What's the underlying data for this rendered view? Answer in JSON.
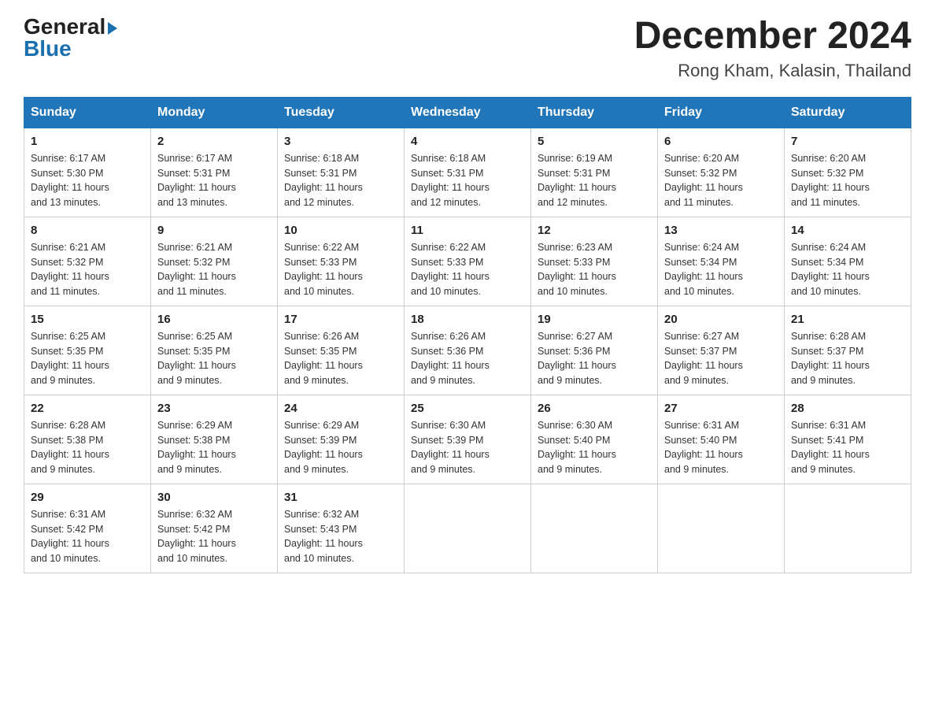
{
  "header": {
    "logo_line1": "General",
    "logo_line2": "Blue",
    "month_year": "December 2024",
    "location": "Rong Kham, Kalasin, Thailand"
  },
  "days_of_week": [
    "Sunday",
    "Monday",
    "Tuesday",
    "Wednesday",
    "Thursday",
    "Friday",
    "Saturday"
  ],
  "weeks": [
    [
      {
        "day": "1",
        "sunrise": "6:17 AM",
        "sunset": "5:30 PM",
        "daylight": "11 hours and 13 minutes."
      },
      {
        "day": "2",
        "sunrise": "6:17 AM",
        "sunset": "5:31 PM",
        "daylight": "11 hours and 13 minutes."
      },
      {
        "day": "3",
        "sunrise": "6:18 AM",
        "sunset": "5:31 PM",
        "daylight": "11 hours and 12 minutes."
      },
      {
        "day": "4",
        "sunrise": "6:18 AM",
        "sunset": "5:31 PM",
        "daylight": "11 hours and 12 minutes."
      },
      {
        "day": "5",
        "sunrise": "6:19 AM",
        "sunset": "5:31 PM",
        "daylight": "11 hours and 12 minutes."
      },
      {
        "day": "6",
        "sunrise": "6:20 AM",
        "sunset": "5:32 PM",
        "daylight": "11 hours and 11 minutes."
      },
      {
        "day": "7",
        "sunrise": "6:20 AM",
        "sunset": "5:32 PM",
        "daylight": "11 hours and 11 minutes."
      }
    ],
    [
      {
        "day": "8",
        "sunrise": "6:21 AM",
        "sunset": "5:32 PM",
        "daylight": "11 hours and 11 minutes."
      },
      {
        "day": "9",
        "sunrise": "6:21 AM",
        "sunset": "5:32 PM",
        "daylight": "11 hours and 11 minutes."
      },
      {
        "day": "10",
        "sunrise": "6:22 AM",
        "sunset": "5:33 PM",
        "daylight": "11 hours and 10 minutes."
      },
      {
        "day": "11",
        "sunrise": "6:22 AM",
        "sunset": "5:33 PM",
        "daylight": "11 hours and 10 minutes."
      },
      {
        "day": "12",
        "sunrise": "6:23 AM",
        "sunset": "5:33 PM",
        "daylight": "11 hours and 10 minutes."
      },
      {
        "day": "13",
        "sunrise": "6:24 AM",
        "sunset": "5:34 PM",
        "daylight": "11 hours and 10 minutes."
      },
      {
        "day": "14",
        "sunrise": "6:24 AM",
        "sunset": "5:34 PM",
        "daylight": "11 hours and 10 minutes."
      }
    ],
    [
      {
        "day": "15",
        "sunrise": "6:25 AM",
        "sunset": "5:35 PM",
        "daylight": "11 hours and 9 minutes."
      },
      {
        "day": "16",
        "sunrise": "6:25 AM",
        "sunset": "5:35 PM",
        "daylight": "11 hours and 9 minutes."
      },
      {
        "day": "17",
        "sunrise": "6:26 AM",
        "sunset": "5:35 PM",
        "daylight": "11 hours and 9 minutes."
      },
      {
        "day": "18",
        "sunrise": "6:26 AM",
        "sunset": "5:36 PM",
        "daylight": "11 hours and 9 minutes."
      },
      {
        "day": "19",
        "sunrise": "6:27 AM",
        "sunset": "5:36 PM",
        "daylight": "11 hours and 9 minutes."
      },
      {
        "day": "20",
        "sunrise": "6:27 AM",
        "sunset": "5:37 PM",
        "daylight": "11 hours and 9 minutes."
      },
      {
        "day": "21",
        "sunrise": "6:28 AM",
        "sunset": "5:37 PM",
        "daylight": "11 hours and 9 minutes."
      }
    ],
    [
      {
        "day": "22",
        "sunrise": "6:28 AM",
        "sunset": "5:38 PM",
        "daylight": "11 hours and 9 minutes."
      },
      {
        "day": "23",
        "sunrise": "6:29 AM",
        "sunset": "5:38 PM",
        "daylight": "11 hours and 9 minutes."
      },
      {
        "day": "24",
        "sunrise": "6:29 AM",
        "sunset": "5:39 PM",
        "daylight": "11 hours and 9 minutes."
      },
      {
        "day": "25",
        "sunrise": "6:30 AM",
        "sunset": "5:39 PM",
        "daylight": "11 hours and 9 minutes."
      },
      {
        "day": "26",
        "sunrise": "6:30 AM",
        "sunset": "5:40 PM",
        "daylight": "11 hours and 9 minutes."
      },
      {
        "day": "27",
        "sunrise": "6:31 AM",
        "sunset": "5:40 PM",
        "daylight": "11 hours and 9 minutes."
      },
      {
        "day": "28",
        "sunrise": "6:31 AM",
        "sunset": "5:41 PM",
        "daylight": "11 hours and 9 minutes."
      }
    ],
    [
      {
        "day": "29",
        "sunrise": "6:31 AM",
        "sunset": "5:42 PM",
        "daylight": "11 hours and 10 minutes."
      },
      {
        "day": "30",
        "sunrise": "6:32 AM",
        "sunset": "5:42 PM",
        "daylight": "11 hours and 10 minutes."
      },
      {
        "day": "31",
        "sunrise": "6:32 AM",
        "sunset": "5:43 PM",
        "daylight": "11 hours and 10 minutes."
      },
      null,
      null,
      null,
      null
    ]
  ],
  "labels": {
    "sunrise": "Sunrise:",
    "sunset": "Sunset:",
    "daylight": "Daylight:"
  }
}
